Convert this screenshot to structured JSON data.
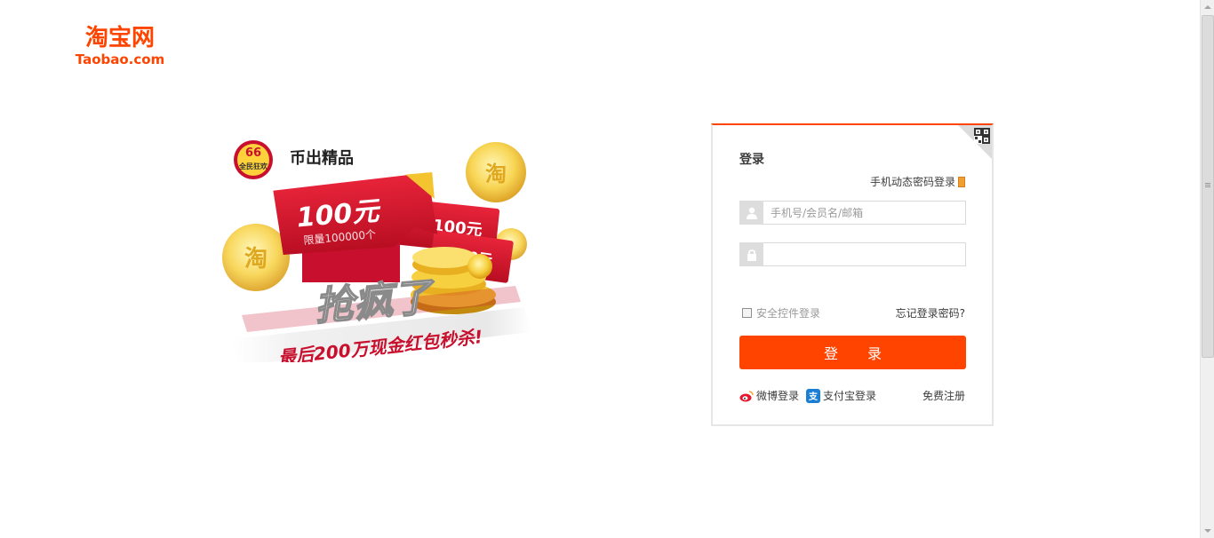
{
  "logo": {
    "cn": "淘宝网",
    "en": "Taobao.com"
  },
  "promo": {
    "badge_top": "66",
    "badge_label": "全民狂欢",
    "brand_tag": "币出精品",
    "coupon_amount": "100元",
    "coupon_limit": "限量100000个",
    "coupon_back1": "100元",
    "coupon_back2": "50元",
    "headline": "抢疯了",
    "subline": "最后200万现金红包秒杀!",
    "coin_char": "淘"
  },
  "login": {
    "title": "登录",
    "sms_login": "手机动态密码登录",
    "username_placeholder": "手机号/会员名/邮箱",
    "username_value": "",
    "password_value": "",
    "secure_login": "安全控件登录",
    "forgot_password": "忘记登录密码?",
    "submit": "登 录",
    "weibo_login": "微博登录",
    "alipay_login": "支付宝登录",
    "register": "免费注册"
  },
  "icons": {
    "user": "user-icon",
    "lock": "lock-icon",
    "qr": "qr-code-icon",
    "weibo": "weibo-icon",
    "alipay": "alipay-icon",
    "phone": "phone-icon"
  },
  "colors": {
    "accent": "#ff4400",
    "input_border": "#d9d9d9",
    "icon_bg": "#dddddd"
  }
}
